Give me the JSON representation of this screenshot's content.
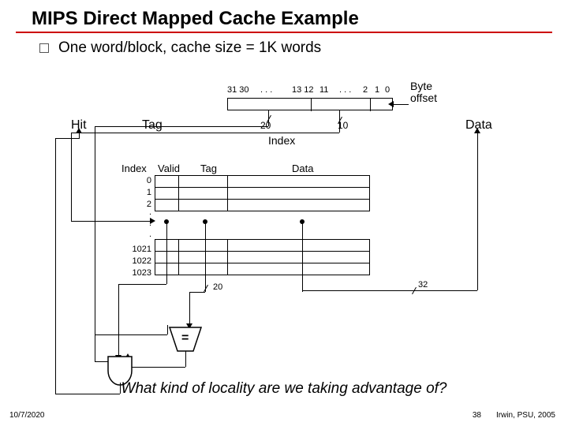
{
  "title": "MIPS Direct Mapped Cache Example",
  "subtitle": "One word/block, cache size = 1K words",
  "labels": {
    "hit": "Hit",
    "tag": "Tag",
    "index": "Index",
    "data": "Data",
    "byte_offset": "Byte\noffset",
    "index_hdr": "Index",
    "valid_hdr": "Valid",
    "tag_hdr": "Tag",
    "data_hdr": "Data"
  },
  "address_bits": {
    "b31": "31 30",
    "dots1": ". . .",
    "b13": "13 12",
    "b11": "11",
    "dots2": ". . .",
    "b2": "2",
    "b1": "1",
    "b0": "0"
  },
  "widths": {
    "tag": "20",
    "index10": "10",
    "tag_cmp": "20",
    "data_out": "32"
  },
  "row_indices": {
    "r0": "0",
    "r1": "1",
    "r2": "2",
    "r1021": "1021",
    "r1022": "1022",
    "r1023": "1023"
  },
  "comparator_label": "=",
  "chart_data": {
    "type": "diagram",
    "address_width_bits": 32,
    "fields": [
      {
        "name": "Tag",
        "bits": "31-12",
        "width": 20
      },
      {
        "name": "Index",
        "bits": "11-2",
        "width": 10
      },
      {
        "name": "Byte offset",
        "bits": "1-0",
        "width": 2
      }
    ],
    "cache_rows": 1024,
    "block_size_words": 1,
    "columns": [
      "Valid",
      "Tag",
      "Data"
    ],
    "data_width_bits": 32,
    "outputs": [
      "Hit",
      "Data"
    ]
  },
  "question": "What kind of locality are we taking advantage of?",
  "footer": {
    "date": "10/7/2020",
    "page": "38",
    "credit": "Irwin, PSU, 2005"
  }
}
